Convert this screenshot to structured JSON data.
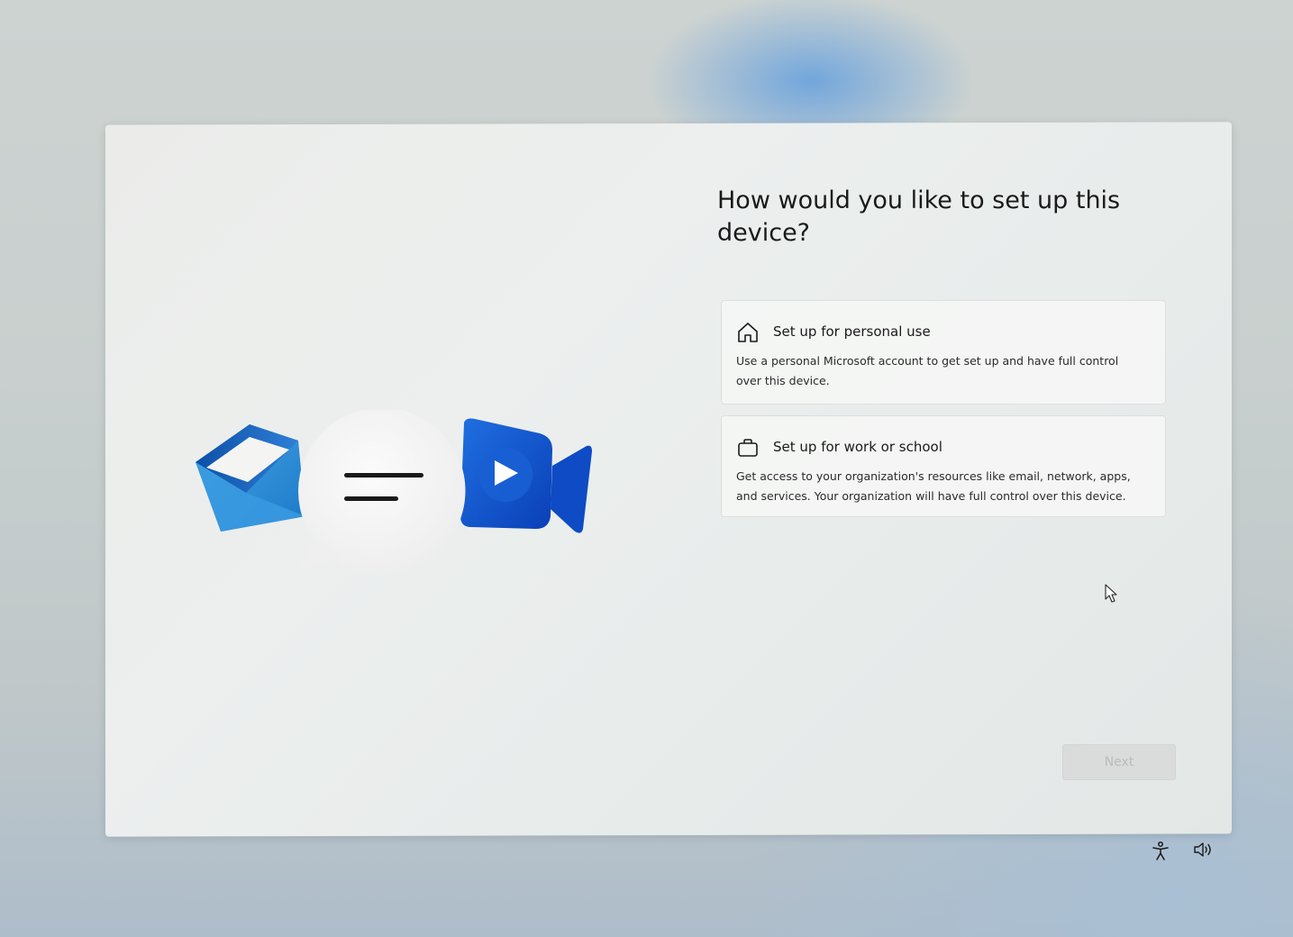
{
  "setup": {
    "heading": "How would you like to set up this device?",
    "options": [
      {
        "icon": "home-icon",
        "title": "Set up for personal use",
        "description": "Use a personal Microsoft account to get set up and have full control over this device."
      },
      {
        "icon": "briefcase-icon",
        "title": "Set up for work or school",
        "description": "Get access to your organization's resources like email, network, apps, and services. Your organization will have full control over this device."
      }
    ],
    "next_label": "Next",
    "next_enabled": false
  },
  "illustration": {
    "icons": [
      "mail-icon",
      "chat-bubble-icon",
      "video-call-icon"
    ]
  },
  "tray": {
    "icons": [
      "accessibility-icon",
      "volume-icon"
    ]
  },
  "colors": {
    "accent_blue": "#0f5fd0",
    "mail_blue": "#1e7fd0",
    "button_disabled": "#d9dcdb"
  }
}
